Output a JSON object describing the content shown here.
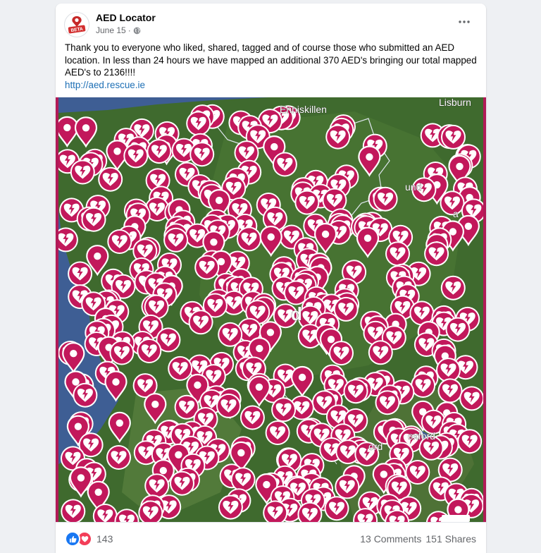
{
  "post": {
    "page_name": "AED Locator",
    "avatar_badge": "BETA",
    "date": "June 15",
    "separator": "·",
    "text": "Thank you to everyone who liked, shared, tagged and of course those who submitted an AED location. In less than 24 hours we have mapped an additional 370 AED's bringing our total mapped AED's to 2136!!!!",
    "link": "http://aed.rescue.ie"
  },
  "map": {
    "place_labels": [
      "Enniskillen",
      "Lisburn",
      "und",
      "a",
      "d",
      "exford",
      "ord"
    ],
    "marker_color": "#c2185b",
    "marker_icon": "heart-lightning-icon",
    "pin_icon": "map-pin-icon"
  },
  "footer": {
    "reaction_count": "143",
    "comments": "13 Comments",
    "shares": "151 Shares"
  },
  "colors": {
    "frame": "#b11a57",
    "sea": "#3e5e94",
    "land": "#3f6a2e",
    "link": "#1d6fb5"
  }
}
